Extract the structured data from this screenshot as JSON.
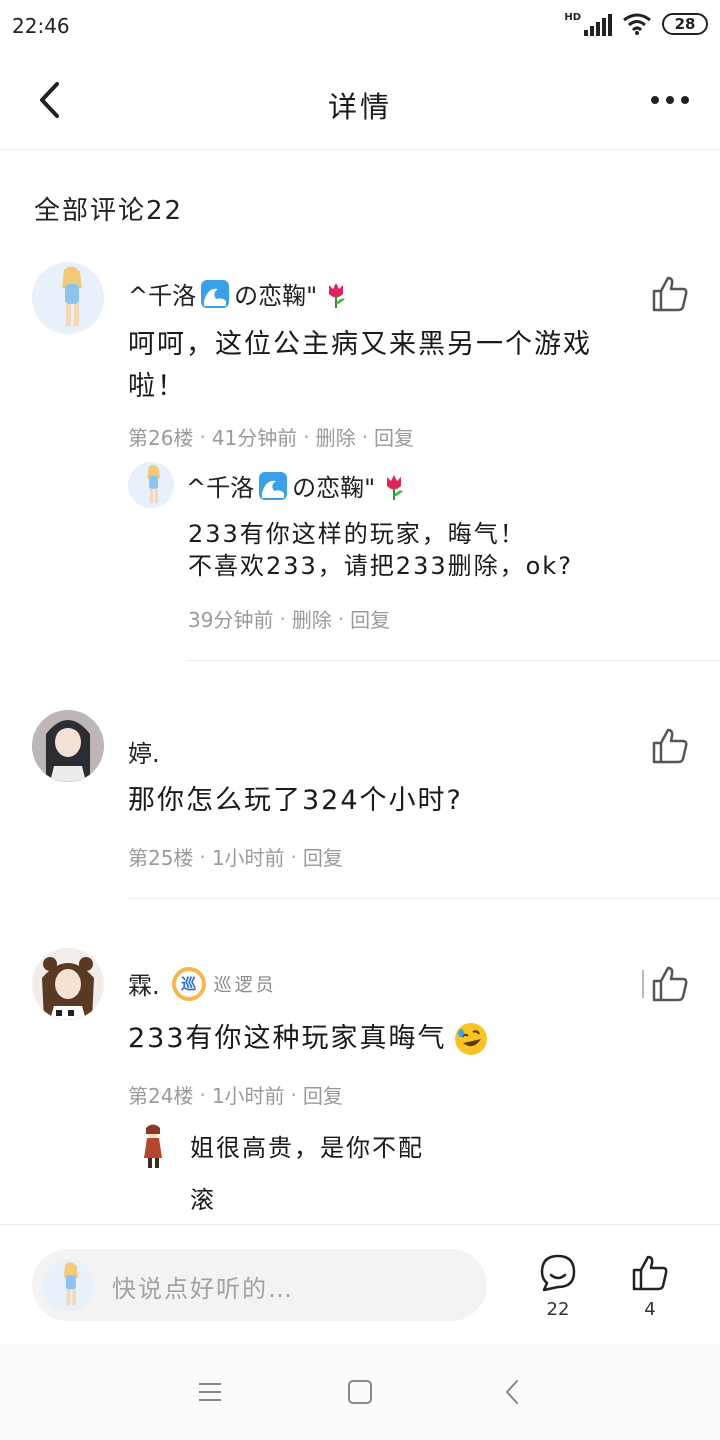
{
  "status_bar": {
    "time": "22:46",
    "network": "HD",
    "battery": "28"
  },
  "header": {
    "title": "详情"
  },
  "comments_section": {
    "title": "全部评论22"
  },
  "comments": [
    {
      "username": "^千洛",
      "username_suffix": "の恋鞠\"",
      "content": "呵呵，这位公主病又来黑另一个游戏啦！",
      "floor": "第26楼",
      "time": "41分钟前",
      "delete_label": "删除",
      "reply_label": "回复",
      "reply": {
        "username": "^千洛",
        "username_suffix": "の恋鞠\"",
        "content_line1": "233有你这样的玩家，晦气！",
        "content_line2": "不喜欢233，请把233删除，ok?",
        "time": "39分钟前",
        "delete_label": "删除",
        "reply_label": "回复"
      }
    },
    {
      "username": "婷.",
      "content": "那你怎么玩了324个小时?",
      "floor": "第25楼",
      "time": "1小时前",
      "reply_label": "回复"
    },
    {
      "username": "霖.",
      "badge_icon_text": "巡",
      "badge_label": "巡逻员",
      "content": "233有你这种玩家真晦气",
      "floor": "第24楼",
      "time": "1小时前",
      "reply_label": "回复",
      "sub_replies": [
        "姐很高贵，是你不配",
        "滚"
      ]
    }
  ],
  "input_bar": {
    "placeholder": "快说点好听的…",
    "comment_count": "22",
    "like_count": "4"
  },
  "colors": {
    "meta_text": "#9a9a9a",
    "badge_gold": "#f5b74e",
    "badge_blue": "#2c6fd6",
    "divider": "#ececec"
  }
}
